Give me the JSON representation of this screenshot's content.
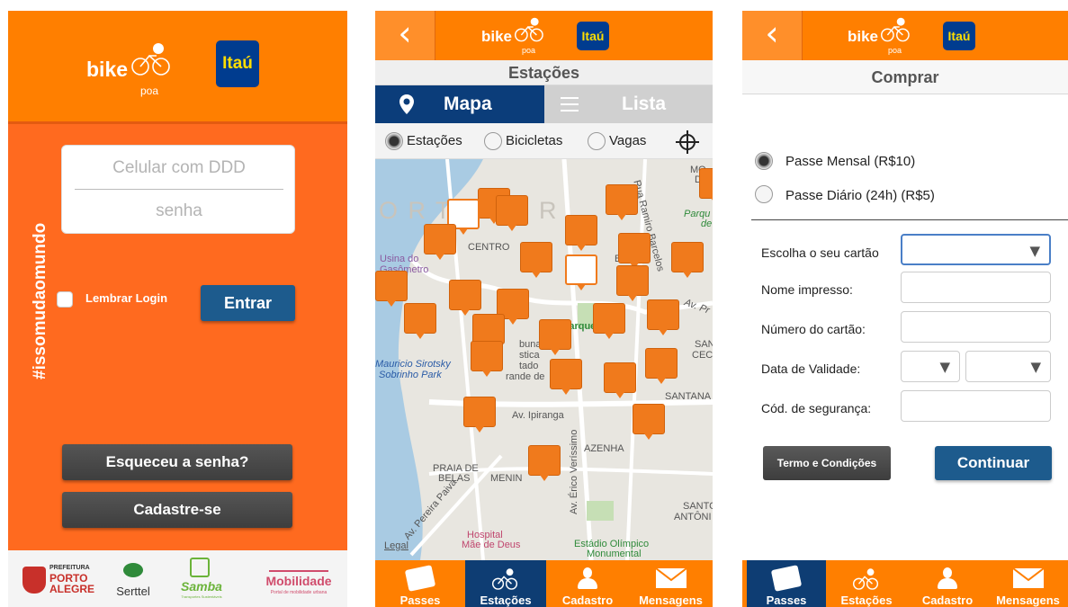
{
  "brand": {
    "bike": "bike",
    "poa": "poa",
    "itau": "Itaú"
  },
  "colors": {
    "orange": "#ff7f00",
    "navy": "#0e3d73",
    "button_blue": "#1d5b8d"
  },
  "login": {
    "phone_placeholder": "Celular com DDD",
    "password_placeholder": "senha",
    "hashtag": "#issomudaomundo",
    "remember_label": "Lembrar Login",
    "enter_button": "Entrar",
    "forgot_button": "Esqueceu a senha?",
    "signup_button": "Cadastre-se",
    "sponsors": {
      "prefeitura_small": "PREFEITURA",
      "prefeitura_main": "PORTO ALEGRE",
      "serttel": "Serttel",
      "samba": "Samba",
      "samba_sub": "Transportes Sustentáveis",
      "mobilidade": "Mobilidade",
      "mobilidade_sub": "Portal de mobilidade urbana"
    }
  },
  "stations": {
    "title": "Estações",
    "segment_map": "Mapa",
    "segment_list": "Lista",
    "filters": [
      "Estações",
      "Bicicletas",
      "Vagas"
    ],
    "map_labels": {
      "centro": "CENTRO",
      "usina": "Usina do",
      "gasometro": "Gasômetro",
      "parque": "Parque",
      "mauricio1": "Mauricio Sirotsky",
      "mauricio2": "Sobrinho Park",
      "ipiranga": "Av. Ipiranga",
      "azenha": "AZENHA",
      "praia1": "PRAIA DE",
      "praia2": "BELAS",
      "menino": "MENIN",
      "erico": "Av. Érico Veríssimo",
      "santo1": "SANTO",
      "santo2": "ANTÔNI",
      "santana": "SANTANA",
      "hospital1": "Hospital",
      "hospital2": "Mãe de Deus",
      "estadio1": "Estádio Olímpico",
      "estadio2": "Monumental",
      "legal": "Legal",
      "rua_ramiro": "Rua Ramiro Barcelos",
      "parqe_r": "Parqu",
      "de_r": "de",
      "mo": "MO",
      "d_r": "D",
      "bo": "BO",
      "buna": "buna",
      "stica": "stica",
      "tado": "tado",
      "grande": "rande de",
      "av_pr": "Av. Pr",
      "san": "SAN",
      "cec": "CEC",
      "pereira": "Av. Pereira Paiva",
      "big_word": "O R T     L E G R"
    },
    "tabs": [
      "Passes",
      "Estações",
      "Cadastro",
      "Mensagens"
    ]
  },
  "purchase": {
    "title": "Comprar",
    "options": [
      "Passe Mensal (R$10)",
      "Passe Diário (24h) (R$5)"
    ],
    "fields": {
      "card": "Escolha o seu cartão",
      "name": "Nome impresso:",
      "number": "Número do cartão:",
      "validity": "Data de Validade:",
      "cvv": "Cód. de segurança:"
    },
    "terms_button": "Termo e Condições",
    "continue_button": "Continuar",
    "tabs": [
      "Passes",
      "Estações",
      "Cadastro",
      "Mensagens"
    ]
  }
}
